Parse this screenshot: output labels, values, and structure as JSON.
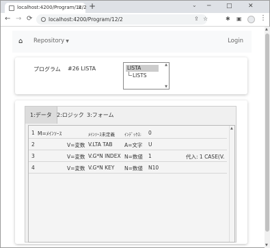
{
  "browser": {
    "tab_title": "localhost:4200/Program/12/2",
    "tab_close": "×",
    "new_tab": "+",
    "url": "localhost:4200/Program/12/2",
    "icons": {
      "back": "←",
      "forward": "→",
      "reload": "⟳",
      "share": "⇪",
      "star": "☆",
      "extensions": "✱",
      "sidepanel": "▣",
      "menu": "⋮",
      "minimize": "─",
      "maximize": "□",
      "close": "✕",
      "tab_dropdown": "⌄"
    }
  },
  "navbar": {
    "home_icon": "⌂",
    "repository_label": "Repository",
    "caret": "▼",
    "login_label": "Login"
  },
  "program": {
    "label": "プログラム",
    "value": "#26 LISTA",
    "tree_items": [
      "LISTA",
      "LISTS"
    ]
  },
  "tabs": [
    {
      "label": "1:データ",
      "active": true
    },
    {
      "label": "2:ロジック",
      "active": false
    },
    {
      "label": "3:フォーム",
      "active": false
    }
  ],
  "table": {
    "rows": [
      {
        "no": "1",
        "kind": "M=ﾒｲﾝｿｰｽ",
        "name": "ﾒｲﾝｿｰｽ未定義",
        "type": "ｲﾝﾃﾞｯｸｽ:",
        "size": "0",
        "extra": ""
      },
      {
        "no": "2",
        "kind": "V=変数",
        "name": "V.LTA TAB",
        "type": "A=文字",
        "size": "U",
        "extra": ""
      },
      {
        "no": "3",
        "kind": "V=変数",
        "name": "V.G*N INDEX",
        "type": "N=数値",
        "size": "1",
        "extra": "代入: 1  CASE(V."
      },
      {
        "no": "4",
        "kind": "V=変数",
        "name": "V.G*N KEY",
        "type": "N=数値",
        "size": "N10",
        "extra": ""
      }
    ]
  }
}
